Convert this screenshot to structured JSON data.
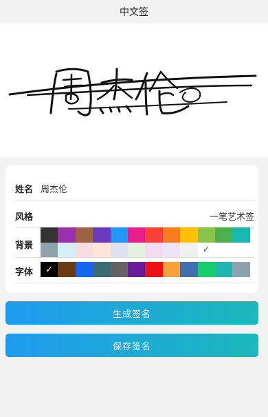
{
  "header": {
    "title": "中文签"
  },
  "signature": {
    "text": "周杰伦",
    "ink_color": "#111111"
  },
  "form": {
    "name_label": "姓名",
    "name_value": "周杰伦",
    "style_label": "风格",
    "style_value": "一笔艺术签",
    "background_label": "背景",
    "font_label": "字体"
  },
  "background_colors": [
    "#333333",
    "#9b2fae",
    "#9e6244",
    "#6b3bbd",
    "#2196f3",
    "#e91e8c",
    "#f44336",
    "#f57c1f",
    "#ffc107",
    "#8bc34a",
    "#4caf50",
    "#1ab6b0",
    "#8fa2ab",
    "#d4eef3",
    "#f8dde0",
    "#fce4d6",
    "#e1dff3",
    "#e4f1de",
    "#f1dcef",
    "#ebe5f5",
    "#f0f0f0",
    "#ffffff"
  ],
  "background_selected_index": 21,
  "font_colors": [
    "#000000",
    "#6b3a10",
    "#1565f0",
    "#3a6b73",
    "#636363",
    "#6a1b9a",
    "#ee1111",
    "#f7a23a",
    "#3f6fb0",
    "#15d06a",
    "#1fb6b0",
    "#8fa2ab"
  ],
  "font_selected_index": 0,
  "buttons": {
    "generate_label": "生成签名",
    "save_label": "保存签名"
  }
}
